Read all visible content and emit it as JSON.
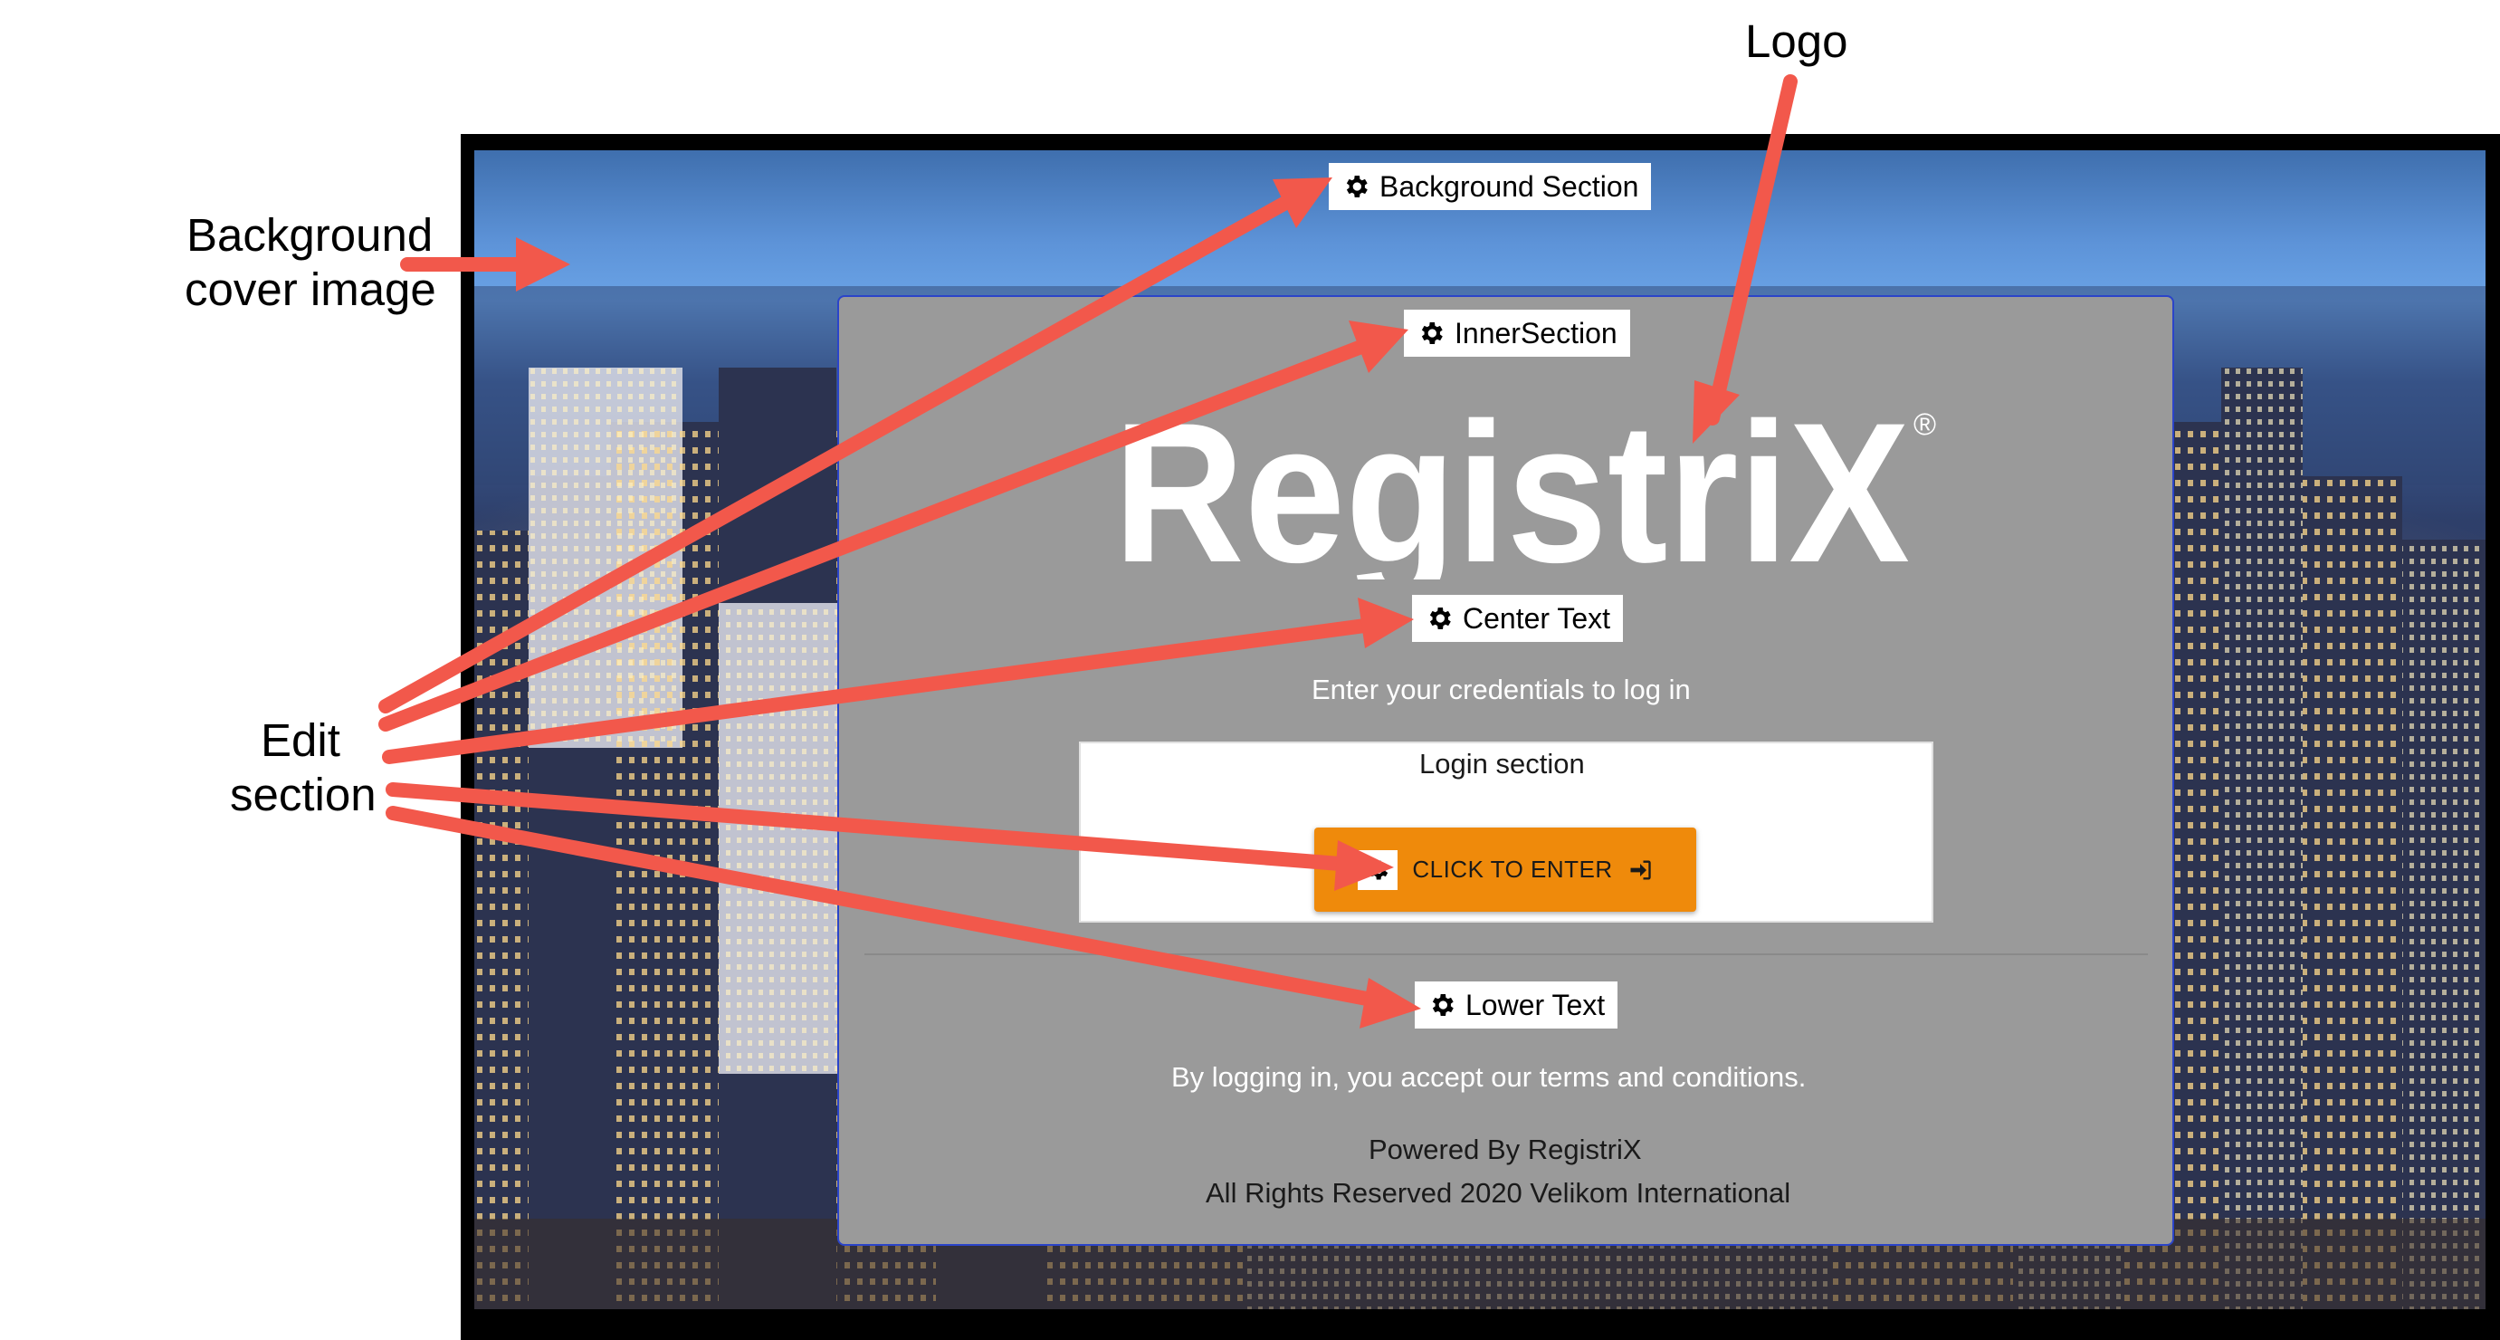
{
  "annotations": {
    "logo": "Logo",
    "background_line1": "Background",
    "background_line2": "cover image",
    "edit_line1": "Edit",
    "edit_line2": "section"
  },
  "sections": {
    "background": "Background Section",
    "inner": "InnerSection",
    "center": "Center Text",
    "lower": "Lower Text"
  },
  "login": {
    "prompt": "Enter your credentials to log in",
    "section_label": "Login section",
    "button_label": "CLICK TO ENTER"
  },
  "logo_text": "RegistriX",
  "logo_mark": "®",
  "footer": {
    "terms": "By logging  in, you accept our terms and conditions.",
    "powered": "Powered By RegistriX",
    "rights": "All Rights Reserved 2020 Velikom International"
  },
  "colors": {
    "arrow": "#f2584b",
    "button": "#ef8a0b",
    "inner_bg": "#9a9a9a",
    "inner_border": "#2b44c9"
  },
  "icons": [
    "gear-icon",
    "sign-in-icon",
    "arrow-icon"
  ]
}
